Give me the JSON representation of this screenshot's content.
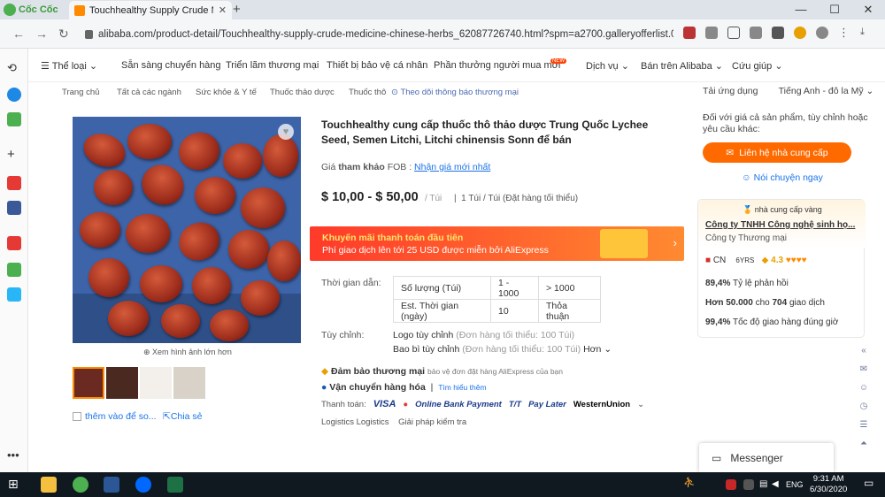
{
  "browser": {
    "brand": "Cốc Cốc",
    "tab_title": "Touchhealthy Supply Crude M",
    "url": "alibaba.com/product-detail/Touchhealthy-supply-crude-medicine-chinese-herbs_62087726740.html?spm=a2700.galleryofferlist.0.0.48811f0a..."
  },
  "topnav": {
    "categories": "Thể loại",
    "items": [
      "Sẵn sàng chuyển hàng",
      "Triển lãm thương mại",
      "Thiết bị bảo vệ cá nhân",
      "Phần thưởng người mua mới",
      "Dịch vụ",
      "Bán trên Alibaba",
      "Cứu giúp"
    ],
    "new_badge": "NEW"
  },
  "breadcrumb": [
    "Trang chủ",
    "Tất cả các ngành",
    "Sức khỏe & Y tế",
    "Thuốc thảo dược",
    "Thuốc thô"
  ],
  "follow_link": "Theo dõi thông báo thương mại",
  "header_right": {
    "download": "Tải ứng dụng",
    "language": "Tiếng Anh - đô la Mỹ"
  },
  "product": {
    "title": "Touchhealthy cung cấp thuốc thô thảo dược Trung Quốc Lychee Seed, Semen Litchi, Litchi chinensis Sonn để bán",
    "price_ref_label": "Giá",
    "price_ref_strong": "tham khảo",
    "price_ref_fob": "FOB :",
    "price_ref_link": "Nhận giá mới nhất",
    "price": "$ 10,00 - $ 50,00",
    "price_unit": "/ Túi",
    "moq": "1 Túi / Túi (Đặt hàng tối thiểu)",
    "view_larger": "Xem hình ảnh lớn hơn",
    "add_fav": "thêm vào để so...",
    "share": "Chia sẻ"
  },
  "promo": {
    "line1": "Khuyến mãi thanh toán đầu tiên",
    "line2": "Phí giao dịch lên tới 25 USD được miễn bởi AliExpress"
  },
  "lead_time": {
    "label": "Thời gian dẫn:",
    "rows": [
      [
        "Số lượng (Túi)",
        "1 - 1000",
        "> 1000"
      ],
      [
        "Est. Thời gian (ngày)",
        "10",
        "Thỏa thuận"
      ]
    ]
  },
  "customization": {
    "label": "Tùy chỉnh:",
    "logo": "Logo tùy chỉnh",
    "logo_note": "(Đơn hàng tối thiểu: 100 Túi)",
    "pack": "Bao bì tùy chỉnh",
    "pack_note": "(Đơn hàng tối thiểu: 100 Túi)",
    "more": "Hơn"
  },
  "assurance": {
    "title": "Đảm bảo thương mại",
    "note": "bảo vệ đơn đặt hàng AliExpress của bạn"
  },
  "shipping": {
    "title": "Vận chuyển hàng hóa",
    "link": "Tìm hiểu thêm"
  },
  "payment": {
    "label": "Thanh toán:",
    "methods": [
      "VISA",
      "Online Bank Payment",
      "T/T",
      "Pay Later",
      "WesternUnion"
    ]
  },
  "logistics": [
    "Logistics Logistics",
    "Giải pháp kiểm tra"
  ],
  "sidebar": {
    "note": "Đối với giá cả sản phẩm, tùy chỉnh hoặc yêu cầu khác:",
    "contact_btn": "Liên hệ nhà cung cấp",
    "chat": "Nói chuyện ngay",
    "gold": "nhà cung cấp vàng",
    "company": "Công ty TNHH Công nghệ sinh họ...",
    "company_type": "Công ty Thương mại",
    "country": "CN",
    "years": "6YRS",
    "rating": "4.3",
    "stats": [
      [
        "89,4%",
        "Tỷ lệ phản hồi"
      ],
      [
        "Hơn 50.000",
        "cho",
        "704",
        "giao dịch"
      ],
      [
        "99,4%",
        "Tốc độ giao hàng đúng giờ"
      ]
    ]
  },
  "messenger": "Messenger",
  "taskbar": {
    "time": "9:31 AM",
    "date": "6/30/2020",
    "lang": "ENG"
  }
}
